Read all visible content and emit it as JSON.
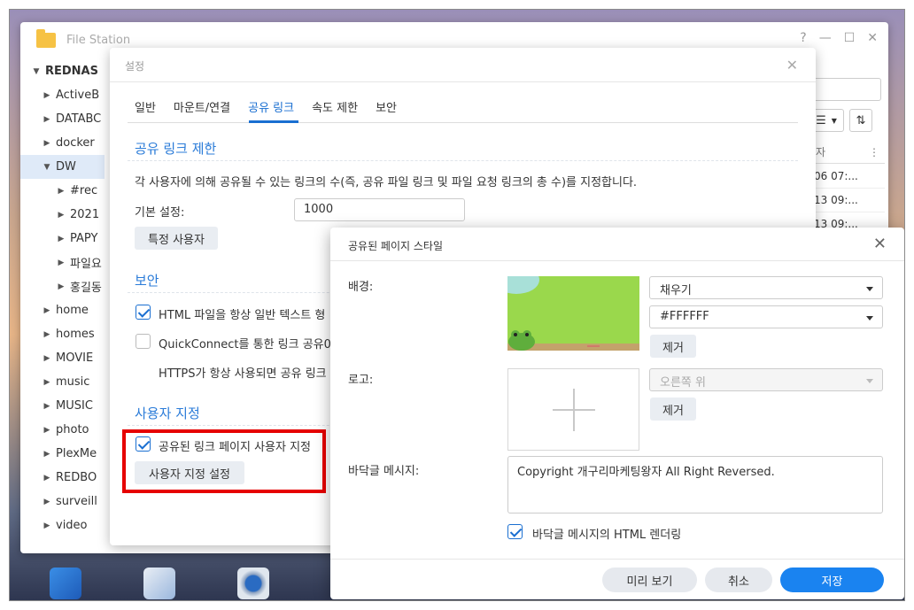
{
  "file_station": {
    "title": "File Station",
    "window_buttons": [
      "?",
      "—",
      "☐",
      "✕"
    ],
    "tree": [
      {
        "label": "REDNAS",
        "arrow": "▼",
        "level": 0,
        "root": true
      },
      {
        "label": "ActiveB",
        "arrow": "▶",
        "level": 1
      },
      {
        "label": "DATABC",
        "arrow": "▶",
        "level": 1
      },
      {
        "label": "docker",
        "arrow": "▶",
        "level": 1
      },
      {
        "label": "DW",
        "arrow": "▼",
        "level": 1,
        "selected": true
      },
      {
        "label": "#rec",
        "arrow": "▶",
        "level": 2
      },
      {
        "label": "2021",
        "arrow": "▶",
        "level": 2
      },
      {
        "label": "PAPY",
        "arrow": "▶",
        "level": 2
      },
      {
        "label": "파일요",
        "arrow": "▶",
        "level": 2
      },
      {
        "label": "홍길동",
        "arrow": "▶",
        "level": 2
      },
      {
        "label": "home",
        "arrow": "▶",
        "level": 1
      },
      {
        "label": "homes",
        "arrow": "▶",
        "level": 1
      },
      {
        "label": "MOVIE",
        "arrow": "▶",
        "level": 1
      },
      {
        "label": "music",
        "arrow": "▶",
        "level": 1
      },
      {
        "label": "MUSIC",
        "arrow": "▶",
        "level": 1
      },
      {
        "label": "photo",
        "arrow": "▶",
        "level": 1
      },
      {
        "label": "PlexMe",
        "arrow": "▶",
        "level": 1
      },
      {
        "label": "REDBO",
        "arrow": "▶",
        "level": 1
      },
      {
        "label": "surveill",
        "arrow": "▶",
        "level": 1
      },
      {
        "label": "video",
        "arrow": "▶",
        "level": 1
      }
    ],
    "column_header": "자",
    "column_menu": "⋮",
    "rows": [
      "06 07:...",
      "13 09:...",
      "13 09:..."
    ],
    "view_icon": "☰",
    "sort_icon": "⇅"
  },
  "settings": {
    "title": "설정",
    "close": "✕",
    "tabs": [
      "일반",
      "마운트/연결",
      "공유 링크",
      "속도 제한",
      "보안"
    ],
    "active_tab": 2,
    "share_limit": {
      "heading": "공유 링크 제한",
      "description": "각 사용자에 의해 공유될 수 있는 링크의 수(즉, 공유 파일 링크 및 파일 요청 링크의 총 수)를 지정합니다.",
      "default_label": "기본 설정:",
      "default_value": "1000",
      "specific_user_button": "특정 사용자"
    },
    "security": {
      "heading": "보안",
      "html_plain_label": "HTML 파일을 항상 일반 텍스트 형",
      "html_plain_checked": true,
      "quickconnect_label": "QuickConnect를 통한 링크 공유0",
      "quickconnect_checked": false,
      "https_note": "HTTPS가 항상 사용되면 공유 링크"
    },
    "customize": {
      "heading": "사용자 지정",
      "custom_page_label": "공유된 링크 페이지 사용자 지정",
      "custom_page_checked": true,
      "custom_settings_button": "사용자 지정 설정"
    }
  },
  "style_dialog": {
    "title": "공유된 페이지 스타일",
    "close": "✕",
    "background_label": "배경:",
    "fill_select": "채우기",
    "color_select": "#FFFFFF",
    "remove_bg_button": "제거",
    "logo_label": "로고:",
    "logo_position_select": "오른쪽 위",
    "remove_logo_button": "제거",
    "footer_label": "바닥글 메시지:",
    "footer_text": "Copyright 개구리마케팅왕자 All Right Reversed.",
    "render_html_label": "바닥글 메시지의 HTML 렌더링",
    "render_html_checked": true,
    "preview_button": "미리 보기",
    "cancel_button": "취소",
    "save_button": "저장"
  },
  "colors": {
    "accent": "#1a6fd1",
    "save": "#1a83f0",
    "highlight": "#e60000",
    "bg_preview": "#9ad84c"
  }
}
